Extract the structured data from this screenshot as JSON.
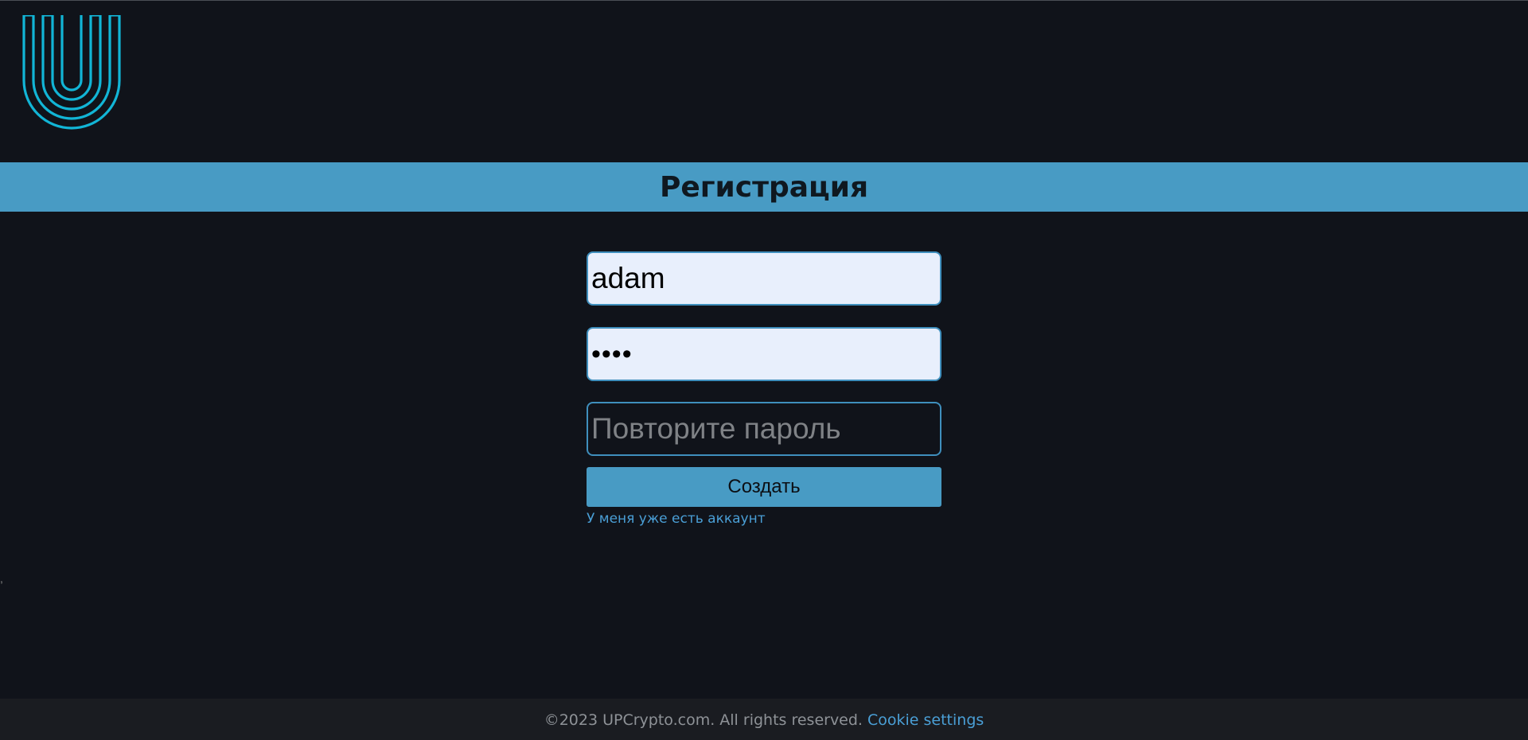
{
  "header": {
    "logo_icon": "up-logo-icon",
    "logo_color": "#12b5d6"
  },
  "banner": {
    "title": "Регистрация",
    "color": "#489bc4"
  },
  "form": {
    "username_value": "adam",
    "password_value": "abcd",
    "confirm_placeholder": "Повторите пароль",
    "submit_label": "Создать",
    "login_link": "У меня уже есть аккаунт"
  },
  "stray_text": ",",
  "footer": {
    "copyright": "©2023 UPCrypto.com. All rights reserved.",
    "cookie_link": "Cookie settings"
  }
}
